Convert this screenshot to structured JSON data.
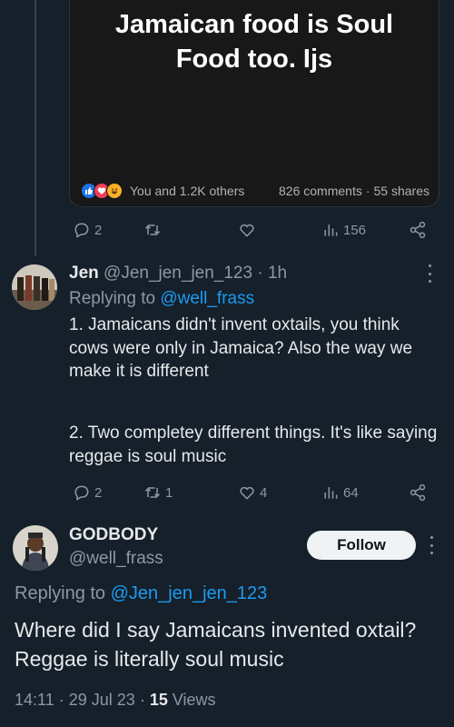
{
  "media": {
    "headline": "Jamaican food is Soul Food too. Ijs",
    "reactions_summary": "You and 1.2K others",
    "comments": "826 comments",
    "separator": "·",
    "shares": "55 shares",
    "reaction_icons": [
      "like-icon",
      "love-icon",
      "haha-icon"
    ]
  },
  "tweet1_actions": {
    "replies": "2",
    "retweets": "",
    "likes": "",
    "views": "156"
  },
  "reply": {
    "name": "Jen",
    "handle": "@Jen_jen_jen_123",
    "time": "· 1h",
    "replying_prefix": "Replying to",
    "replying_to": "@well_frass",
    "paragraph1": "1. Jamaicans didn't invent oxtails, you think cows were only in Jamaica? Also the way we make it is different",
    "paragraph2": "2. Two completey different things. It's like saying reggae is soul music",
    "actions": {
      "replies": "2",
      "retweets": "1",
      "likes": "4",
      "views": "64"
    }
  },
  "main_tweet": {
    "name": "GODBODY",
    "handle": "@well_frass",
    "follow_label": "Follow",
    "replying_prefix": "Replying to",
    "replying_to": "@Jen_jen_jen_123",
    "text": "Where did I say Jamaicans invented oxtail? Reggae is literally soul music",
    "time": "14:11",
    "date": "29 Jul 23",
    "views_count": "15",
    "views_label": "Views"
  },
  "colors": {
    "background": "#15202b",
    "accent": "#1d9bf0",
    "muted": "#8b98a5",
    "text": "#e7e9ea"
  }
}
